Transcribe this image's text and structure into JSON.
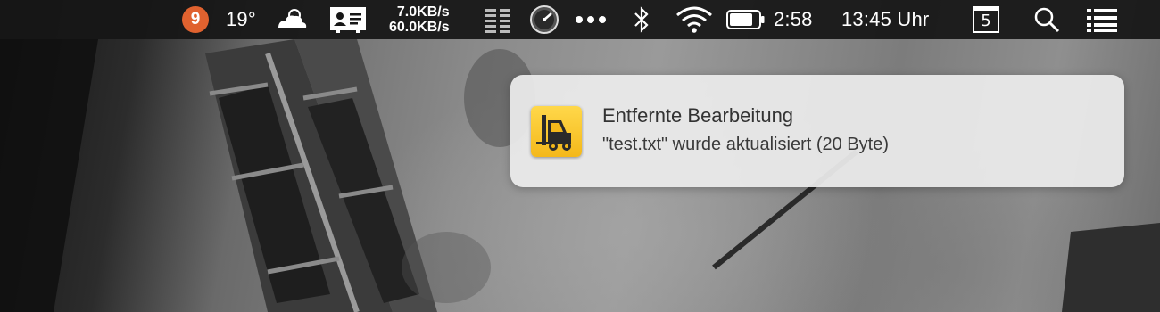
{
  "menubar": {
    "notification_badge": "9",
    "weather_temp": "19°",
    "net_upload": "7.0KB/s",
    "net_download": "60.0KB/s",
    "battery_time": "2:58",
    "clock": "13:45 Uhr",
    "calendar_day": "5",
    "icons": [
      "weather-icon",
      "contact-card-icon",
      "network-speed-icon",
      "activity-gauge-icon",
      "more-dots-icon",
      "bluetooth-icon",
      "wifi-icon",
      "battery-icon",
      "calendar-icon",
      "spotlight-search-icon",
      "notification-center-icon"
    ]
  },
  "notification": {
    "title": "Entfernte Bearbeitung",
    "body": "\"test.txt\" wurde aktualisiert (20 Byte)",
    "app_icon": "forklift-icon",
    "accent_color": "#f4b81a"
  }
}
